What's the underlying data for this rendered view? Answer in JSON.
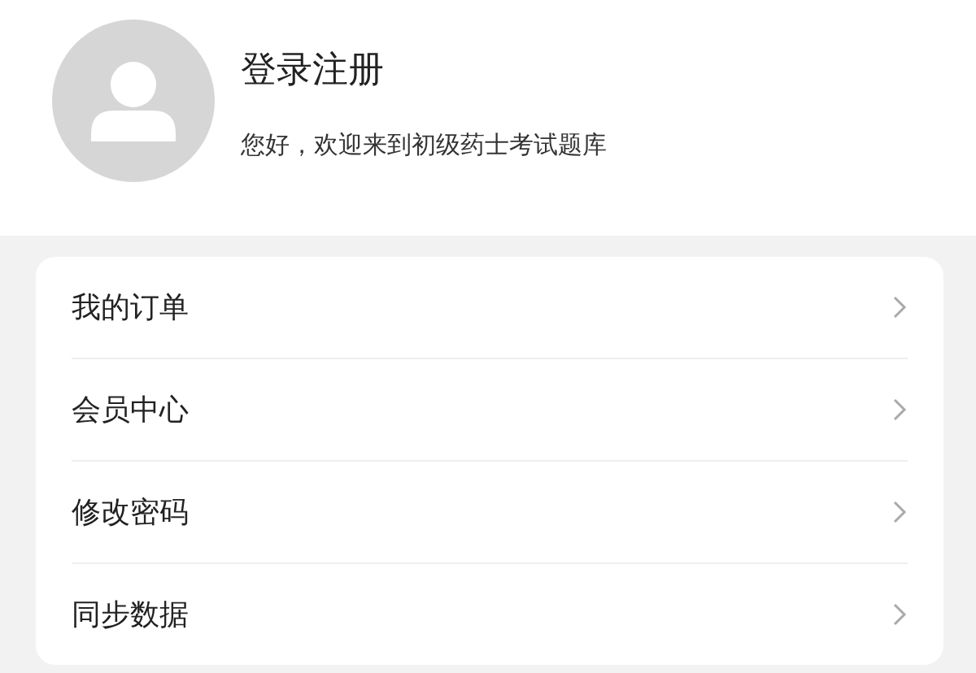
{
  "profile": {
    "title": "登录注册",
    "subtitle": "您好，欢迎来到初级药士考试题库"
  },
  "menu": [
    {
      "label": "我的订单"
    },
    {
      "label": "会员中心"
    },
    {
      "label": "修改密码"
    },
    {
      "label": "同步数据"
    }
  ]
}
